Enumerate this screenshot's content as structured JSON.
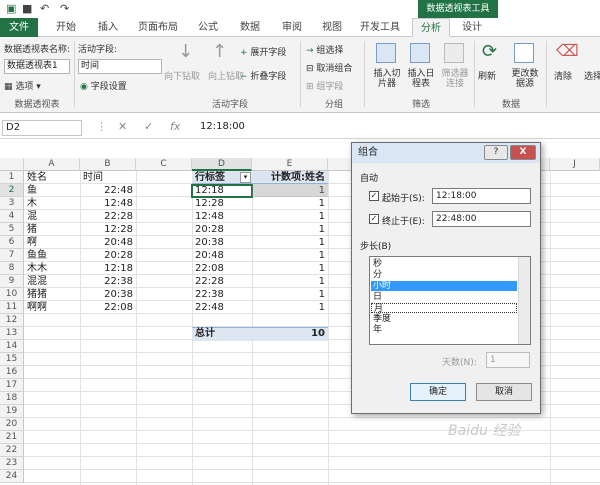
{
  "titlebar": {
    "context_title": "数据透视表工具"
  },
  "tabs": [
    {
      "label": "文件"
    },
    {
      "label": "开始"
    },
    {
      "label": "插入"
    },
    {
      "label": "页面布局"
    },
    {
      "label": "公式"
    },
    {
      "label": "数据"
    },
    {
      "label": "审阅"
    },
    {
      "label": "视图"
    },
    {
      "label": "开发工具"
    },
    {
      "label": "分析"
    },
    {
      "label": "设计"
    }
  ],
  "ribbon": {
    "pivot_name_label": "数据透视表名称:",
    "pivot_name_value": "数据透视表1",
    "options_label": "选项",
    "active_field_label": "活动字段:",
    "active_field_value": "时间",
    "field_settings_label": "字段设置",
    "drill_down_label": "向下钻取",
    "drill_up_label": "向上钻取",
    "expand_field_label": "展开字段",
    "collapse_field_label": "折叠字段",
    "group_selection_label": "组选择",
    "ungroup_label": "取消组合",
    "group_field_label": "组字段",
    "insert_slicer_label": "插入切片器",
    "insert_timeline_label": "插入日程表",
    "filter_connections_label": "筛选器连接",
    "refresh_label": "刷新",
    "change_source_label": "更改数据源",
    "clear_label": "清除",
    "select_label": "选择",
    "group_labels": {
      "pivot": "数据透视表",
      "active_field": "活动字段",
      "group": "分组",
      "filter": "筛选",
      "data": "数据"
    }
  },
  "formula_bar": {
    "name_box": "D2",
    "fx": "fx",
    "formula": "12:18:00"
  },
  "grid": {
    "columns": [
      "A",
      "B",
      "C",
      "D",
      "E",
      "J"
    ],
    "rows": [
      "1",
      "2",
      "3",
      "4",
      "5",
      "6",
      "7",
      "8",
      "9",
      "10",
      "11",
      "12",
      "13",
      "14",
      "15",
      "16",
      "17",
      "18",
      "19",
      "20",
      "21",
      "22",
      "23",
      "24"
    ],
    "headers": {
      "name": "姓名",
      "time": "时间"
    },
    "data_rows": [
      {
        "name": "鱼",
        "time": "22:48"
      },
      {
        "name": "木",
        "time": "12:48"
      },
      {
        "name": "混",
        "time": "22:28"
      },
      {
        "name": "猪",
        "time": "12:28"
      },
      {
        "name": "啊",
        "time": "20:48"
      },
      {
        "name": "鱼鱼",
        "time": "20:28"
      },
      {
        "name": "木木",
        "time": "12:18"
      },
      {
        "name": "混混",
        "time": "22:38"
      },
      {
        "name": "猪猪",
        "time": "20:38"
      },
      {
        "name": "啊啊",
        "time": "22:08"
      }
    ],
    "pivot": {
      "row_label": "行标签",
      "value_label": "计数项:姓名",
      "rows": [
        {
          "label": "12:18",
          "count": "1"
        },
        {
          "label": "12:28",
          "count": "1"
        },
        {
          "label": "12:48",
          "count": "1"
        },
        {
          "label": "20:28",
          "count": "1"
        },
        {
          "label": "20:38",
          "count": "1"
        },
        {
          "label": "20:48",
          "count": "1"
        },
        {
          "label": "22:08",
          "count": "1"
        },
        {
          "label": "22:28",
          "count": "1"
        },
        {
          "label": "22:38",
          "count": "1"
        },
        {
          "label": "22:48",
          "count": "1"
        }
      ],
      "total_label": "总计",
      "total_value": "10"
    }
  },
  "dialog": {
    "title": "组合",
    "help": "?",
    "close": "X",
    "auto_label": "自动",
    "start_label": "起始于(S):",
    "start_value": "12:18:00",
    "end_label": "终止于(E):",
    "end_value": "22:48:00",
    "step_label": "步长(B)",
    "step_options": [
      "秒",
      "分",
      "小时",
      "日",
      "月",
      "季度",
      "年"
    ],
    "days_label": "天数(N):",
    "days_value": "1",
    "ok_label": "确定",
    "cancel_label": "取消"
  },
  "colors": {
    "excel_green": "#217346",
    "pivot_header": "#dce6f0",
    "selection_blue": "#3399ff"
  },
  "watermark": "Baidu 经验"
}
